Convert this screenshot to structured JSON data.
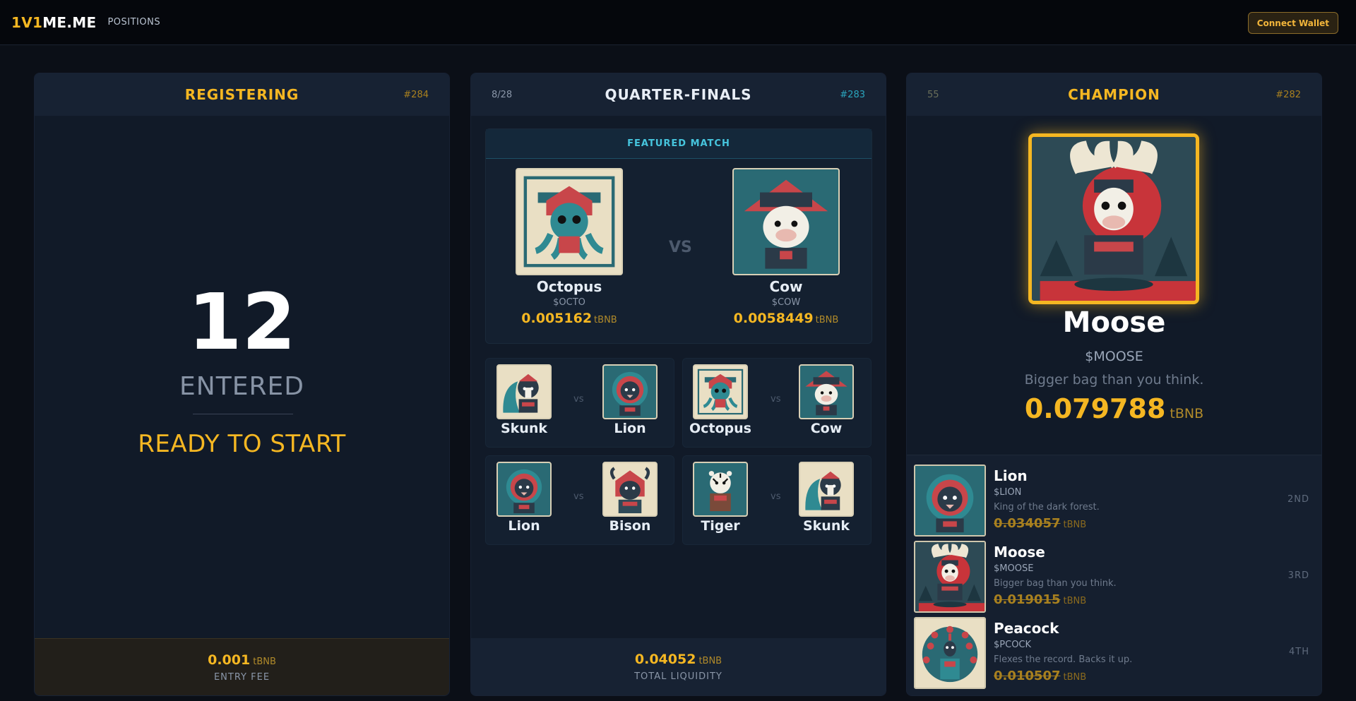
{
  "header": {
    "logo_part1": "1V1",
    "logo_part2": "ME.ME",
    "nav_positions": "POSITIONS",
    "connect_wallet": "Connect Wallet"
  },
  "colors": {
    "accent_gold": "#f5b722",
    "accent_cyan": "#46c5dd",
    "background": "#0b0f17",
    "panel": "#111a28"
  },
  "registering": {
    "title": "REGISTERING",
    "id": "#284",
    "count": "12",
    "count_label": "ENTERED",
    "status": "READY TO START",
    "footer_value": "0.001",
    "footer_unit": "tBNB",
    "footer_label": "ENTRY FEE"
  },
  "quarterfinals": {
    "title": "QUARTER-FINALS",
    "progress": "8/28",
    "id": "#283",
    "featured_label": "FEATURED MATCH",
    "vs": "VS",
    "vs_small": "vs",
    "featured": [
      {
        "name": "Octopus",
        "ticker": "$OCTO",
        "price": "0.005162",
        "unit": "tBNB",
        "icon": "octopus-avatar"
      },
      {
        "name": "Cow",
        "ticker": "$COW",
        "price": "0.0058449",
        "unit": "tBNB",
        "icon": "cow-avatar"
      }
    ],
    "matches": [
      {
        "a": "Skunk",
        "b": "Lion",
        "icon_a": "skunk-avatar",
        "icon_b": "lion-avatar"
      },
      {
        "a": "Octopus",
        "b": "Cow",
        "icon_a": "octopus-avatar",
        "icon_b": "cow-avatar"
      },
      {
        "a": "Lion",
        "b": "Bison",
        "icon_a": "lion-avatar",
        "icon_b": "bison-avatar"
      },
      {
        "a": "Tiger",
        "b": "Skunk",
        "icon_a": "tiger-avatar",
        "icon_b": "skunk-avatar"
      }
    ],
    "footer_value": "0.04052",
    "footer_unit": "tBNB",
    "footer_label": "TOTAL LIQUIDITY"
  },
  "champion": {
    "title": "CHAMPION",
    "left": "55",
    "id": "#282",
    "name": "Moose",
    "ticker": "$MOOSE",
    "description": "Bigger bag than you think.",
    "price": "0.079788",
    "unit": "tBNB",
    "icon": "moose-avatar",
    "runners": [
      {
        "name": "Lion",
        "ticker": "$LION",
        "description": "King of the dark forest.",
        "price": "0.034057",
        "unit": "tBNB",
        "rank": "2ND",
        "icon": "lion-avatar"
      },
      {
        "name": "Moose",
        "ticker": "$MOOSE",
        "description": "Bigger bag than you think.",
        "price": "0.019015",
        "unit": "tBNB",
        "rank": "3RD",
        "icon": "moose-avatar"
      },
      {
        "name": "Peacock",
        "ticker": "$PCOCK",
        "description": "Flexes the record. Backs it up.",
        "price": "0.010507",
        "unit": "tBNB",
        "rank": "4TH",
        "icon": "peacock-avatar"
      }
    ]
  }
}
